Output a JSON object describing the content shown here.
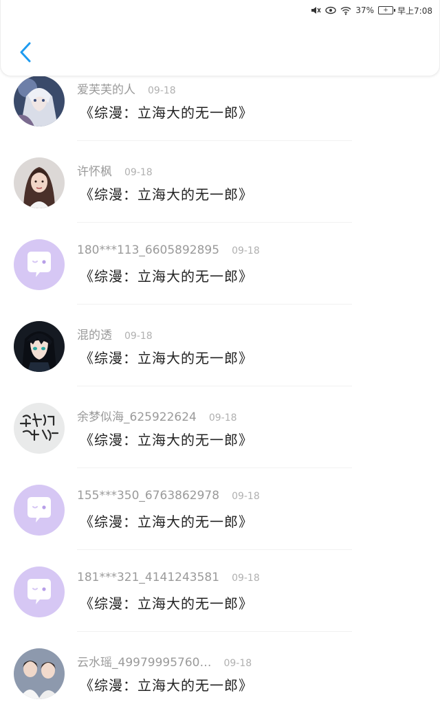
{
  "status_bar": {
    "battery_percent": "37%",
    "time": "早上7:08"
  },
  "header": {
    "back_icon": "chevron-left-icon",
    "accent_color": "#1e9bf0"
  },
  "items": [
    {
      "username": "爱芙芙的人",
      "date": "09-18",
      "book": "《综漫：立海大的无一郎》",
      "avatar": "anime-silver-hair"
    },
    {
      "username": "许怀枫",
      "date": "09-18",
      "book": "《综漫：立海大的无一郎》",
      "avatar": "photo-girl"
    },
    {
      "username": "180***113_6605892895",
      "date": "09-18",
      "book": "《综漫：立海大的无一郎》",
      "avatar": "default-chat-bubble"
    },
    {
      "username": "混的透",
      "date": "09-18",
      "book": "《综漫：立海大的无一郎》",
      "avatar": "anime-dark-hair"
    },
    {
      "username": "余梦似海_625922624",
      "date": "09-18",
      "book": "《综漫：立海大的无一郎》",
      "avatar": "calligraphy"
    },
    {
      "username": "155***350_6763862978",
      "date": "09-18",
      "book": "《综漫：立海大的无一郎》",
      "avatar": "default-chat-bubble"
    },
    {
      "username": "181***321_4141243581",
      "date": "09-18",
      "book": "《综漫：立海大的无一郎》",
      "avatar": "default-chat-bubble"
    },
    {
      "username": "云水瑶_49979995760…",
      "date": "09-18",
      "book": "《综漫：立海大的无一郎》",
      "avatar": "photo-two-boys"
    }
  ]
}
